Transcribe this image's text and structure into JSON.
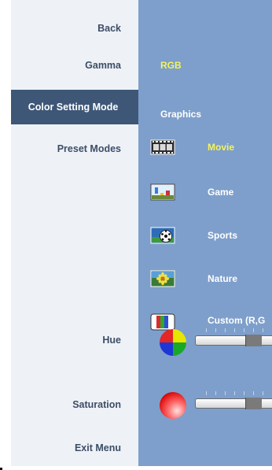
{
  "menu": {
    "back_label": "Back",
    "gamma_label": "Gamma",
    "color_setting_mode_label": "Color Setting Mode",
    "preset_modes_label": "Preset Modes",
    "hue_label": "Hue",
    "saturation_label": "Saturation",
    "exit_label": "Exit Menu"
  },
  "panel": {
    "gamma_value": "RGB",
    "color_mode_value": "Graphics",
    "presets": [
      {
        "label": "Movie",
        "selected": true,
        "icon": "film-strip-icon"
      },
      {
        "label": "Game",
        "selected": false,
        "icon": "game-icon"
      },
      {
        "label": "Sports",
        "selected": false,
        "icon": "soccer-ball-icon"
      },
      {
        "label": "Nature",
        "selected": false,
        "icon": "flower-icon"
      },
      {
        "label": "Custom (R,G",
        "selected": false,
        "icon": "rgb-bars-icon"
      }
    ],
    "hue": {
      "icon": "color-wheel-icon",
      "level": 0.82
    },
    "saturation": {
      "icon": "red-sphere-icon",
      "level": 0.82
    }
  },
  "colors": {
    "left_bg": "#eef2f7",
    "right_bg": "#7e9fcb",
    "selected_bg": "#3e5777",
    "highlight_text": "#f4f45a"
  }
}
